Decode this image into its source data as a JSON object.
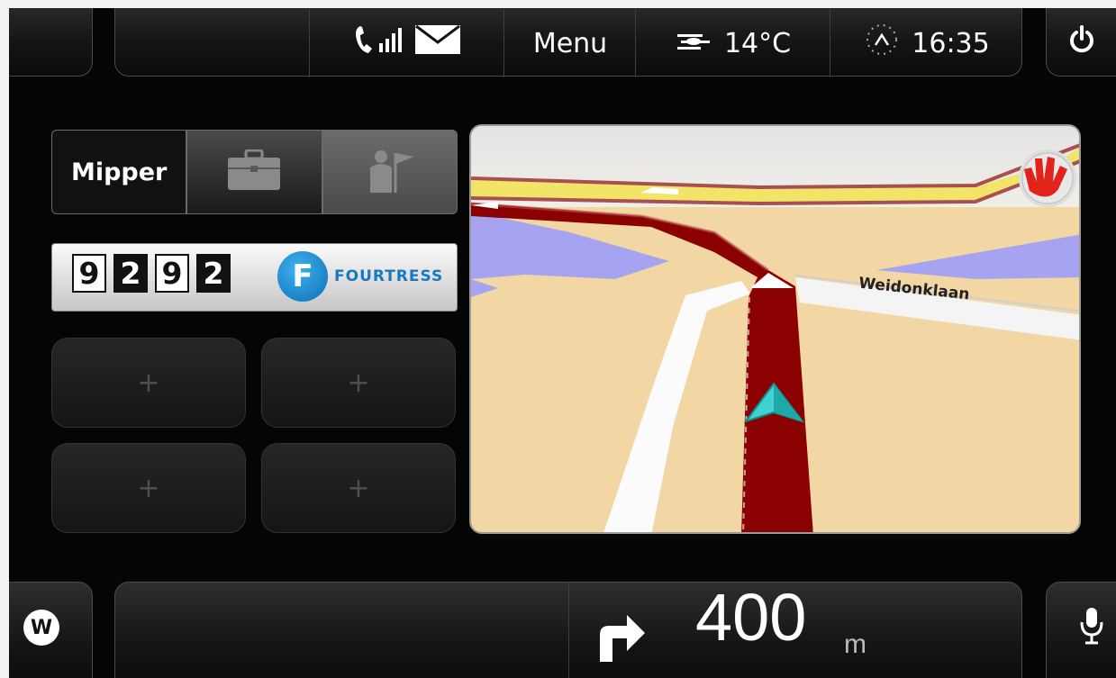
{
  "status_bar": {
    "comm_icons": [
      "phone-icon",
      "signal-icon",
      "mail-icon"
    ],
    "menu_label": "Menu",
    "temperature": "14°C",
    "time": "16:35"
  },
  "profile_tabs": {
    "name": "Mipper",
    "work_icon": "briefcase-icon",
    "tour_icon": "tourist-flag-icon"
  },
  "plate": {
    "digits": [
      "9",
      "2",
      "9",
      "2"
    ],
    "brand": "FOURTRESS",
    "brand_initial": "F"
  },
  "shortcut_slots": [
    "+",
    "+",
    "+",
    "+"
  ],
  "map": {
    "street_name": "Weidonklaan",
    "logo_icon": "tomtom-hand-icon",
    "colors": {
      "land": "#f2d7a4",
      "water": "#a6a4f0",
      "route": "#8b0000",
      "major_road": "#f2e466"
    }
  },
  "guidance": {
    "w_label": "W",
    "distance": "400",
    "unit": "m",
    "turn_icon": "turn-right-arrow-icon"
  },
  "power_icon": "power-icon",
  "mic_icon": "microphone-icon"
}
